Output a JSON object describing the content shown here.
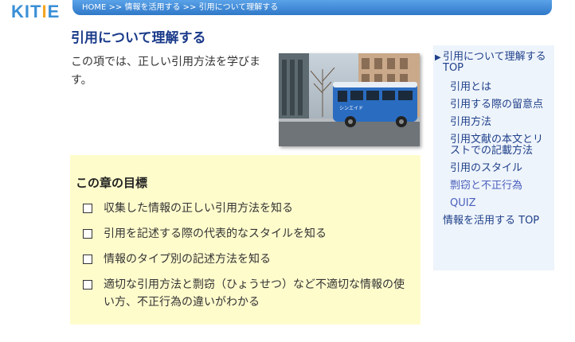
{
  "logo": {
    "text_a": "KIT",
    "text_b": "I",
    "text_c": "E"
  },
  "breadcrumb": "HOME >> 情報を活用する >> 引用について理解する",
  "page_title": "引用について理解する",
  "intro": "この項では、正しい引用方法を学びます。",
  "goals": {
    "title": "この章の目標",
    "items": [
      "収集した情報の正しい引用方法を知る",
      "引用を記述する際の代表的なスタイルを知る",
      "情報のタイプ別の記述方法を知る",
      "適切な引用方法と剽窃（ひょうせつ）など不適切な情報の使い方、不正行為の違いがわかる"
    ]
  },
  "bus": {
    "sign": "シンエイド"
  },
  "side_nav": {
    "top": "引用について理解する TOP",
    "items": [
      "引用とは",
      "引用する際の留意点",
      "引用方法",
      "引用文献の本文とリストでの記載方法",
      "引用のスタイル",
      "剽窃と不正行為",
      "QUIZ"
    ],
    "parent": "情報を活用する TOP"
  },
  "colors": {
    "accent": "#2f78c8",
    "title": "#1a3a8a",
    "goals_bg": "#fffccc",
    "nav_bg": "#eef4fb"
  }
}
